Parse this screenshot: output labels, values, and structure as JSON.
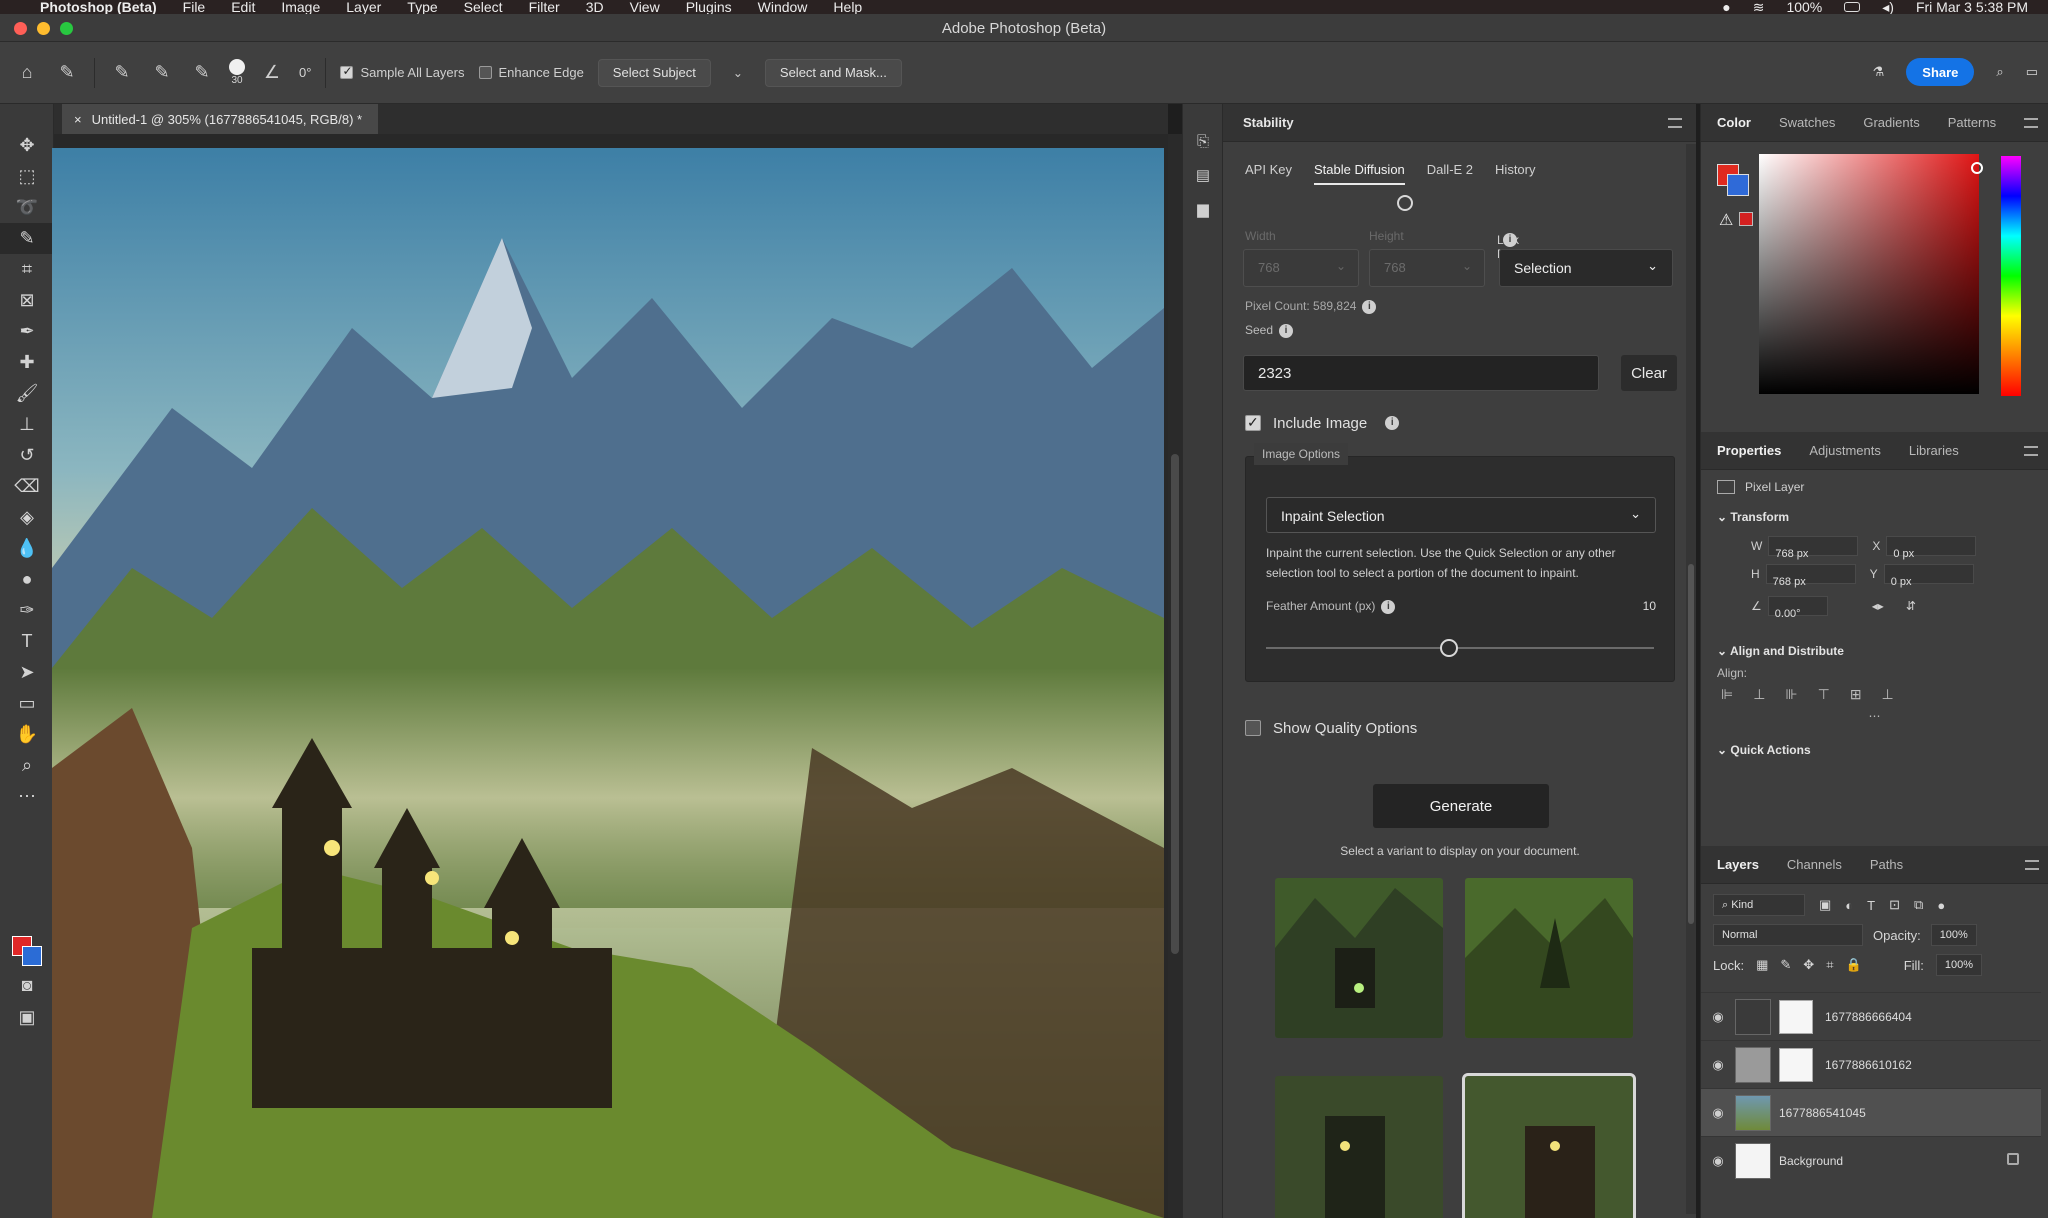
{
  "menubar": {
    "app": "Photoshop (Beta)",
    "items": [
      "File",
      "Edit",
      "Image",
      "Layer",
      "Type",
      "Select",
      "Filter",
      "3D",
      "View",
      "Plugins",
      "Window",
      "Help"
    ],
    "battery": "100%",
    "clock": "Fri Mar 3  5:38 PM"
  },
  "window": {
    "title": "Adobe Photoshop (Beta)"
  },
  "options": {
    "brush_size": "30",
    "angle": "0°",
    "sample_all_layers": "Sample All Layers",
    "enhance_edge": "Enhance Edge",
    "select_subject": "Select Subject",
    "select_and_mask": "Select and Mask...",
    "share": "Share"
  },
  "document": {
    "tab": "Untitled-1 @ 305% (1677886541045, RGB/8) *"
  },
  "stability": {
    "panel_title": "Stability",
    "tabs": [
      "API Key",
      "Stable Diffusion",
      "Dall-E 2",
      "History"
    ],
    "width_label": "Width",
    "height_label": "Height",
    "link_dimensions": "Link Dimensions",
    "width_value": "768",
    "height_value": "768",
    "link_value": "Selection",
    "pixel_count": "Pixel Count: 589,824",
    "seed_label": "Seed",
    "seed_value": "2323",
    "clear": "Clear",
    "include_image": "Include Image",
    "image_options": "Image Options",
    "inpaint_mode": "Inpaint Selection",
    "inpaint_desc": "Inpaint the current selection. Use the Quick Selection or any other selection tool to select a portion of the document to inpaint.",
    "feather_label": "Feather Amount (px)",
    "feather_value": "10",
    "show_quality": "Show Quality Options",
    "generate": "Generate",
    "variant_hint": "Select a variant to display on your document."
  },
  "color_panel": {
    "tabs": [
      "Color",
      "Swatches",
      "Gradients",
      "Patterns"
    ]
  },
  "properties": {
    "tabs": [
      "Properties",
      "Adjustments",
      "Libraries"
    ],
    "layer_kind": "Pixel Layer",
    "transform": "Transform",
    "w": "768 px",
    "h": "768 px",
    "x": "0 px",
    "y": "0 px",
    "angle": "0.00°",
    "align_distribute": "Align and Distribute",
    "align": "Align:",
    "quick_actions": "Quick Actions"
  },
  "layers": {
    "tabs": [
      "Layers",
      "Channels",
      "Paths"
    ],
    "kind": "Kind",
    "blend": "Normal",
    "opacity_label": "Opacity:",
    "opacity": "100%",
    "lock_label": "Lock:",
    "fill_label": "Fill:",
    "fill": "100%",
    "items": [
      {
        "name": "1677886666404"
      },
      {
        "name": "1677886610162"
      },
      {
        "name": "1677886541045"
      },
      {
        "name": "Background"
      }
    ]
  },
  "colors": {
    "accent": "#1473e6",
    "foreground": "#e02828",
    "background": "#2b6cd6"
  }
}
